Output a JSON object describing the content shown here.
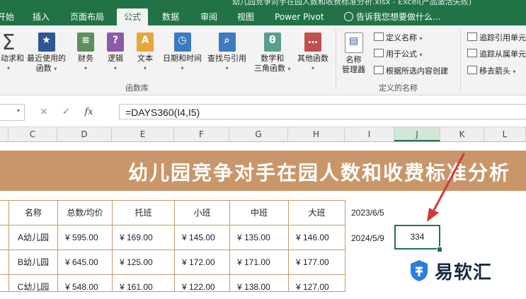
{
  "title_fragment": "幼儿园竞争对手在园人数和收费标准分析.xlsx - Excel(产品激活失败)",
  "tabs": [
    {
      "label": "开始",
      "active": false
    },
    {
      "label": "插入",
      "active": false
    },
    {
      "label": "页面布局",
      "active": false
    },
    {
      "label": "公式",
      "active": true
    },
    {
      "label": "数据",
      "active": false
    },
    {
      "label": "审阅",
      "active": false
    },
    {
      "label": "视图",
      "active": false
    },
    {
      "label": "Power Pivot",
      "active": false
    }
  ],
  "tell_me": "告诉我您想要做什么...",
  "ribbon": {
    "function_library": {
      "label": "函数库",
      "buttons": [
        {
          "label": "自动求和",
          "icon": "sigma-icon"
        },
        {
          "label1": "最近使用的",
          "label2": "函数",
          "icon": "star-book-icon"
        },
        {
          "label": "财务",
          "icon": "coins-book-icon"
        },
        {
          "label": "逻辑",
          "icon": "question-book-icon"
        },
        {
          "label": "文本",
          "icon": "letter-a-book-icon"
        },
        {
          "label": "日期和时间",
          "icon": "clock-book-icon"
        },
        {
          "label": "查找与引用",
          "icon": "magnifier-book-icon"
        },
        {
          "label1": "数学和",
          "label2": "三角函数",
          "icon": "theta-book-icon"
        },
        {
          "label": "其他函数",
          "icon": "more-book-icon"
        }
      ]
    },
    "defined_names": {
      "label": "定义的名称",
      "name_manager1": "名称",
      "name_manager2": "管理器",
      "define_name": "定义名称",
      "use_in_formula": "用于公式",
      "create_from_selection": "根据所选内容创建"
    },
    "formula_auditing": {
      "trace_precedents": "追踪引用单元格",
      "trace_dependents": "追踪从属单元格",
      "remove_arrows": "移去箭头"
    }
  },
  "formula_bar": {
    "name_box": "",
    "cancel_icon": "×",
    "enter_icon": "✓",
    "fx_label": "fx",
    "formula": "=DAYS360(I4,I5)"
  },
  "columns": [
    "C",
    "D",
    "E",
    "F",
    "G",
    "H",
    "I",
    "J",
    "K",
    "L"
  ],
  "selected_column": "J",
  "sheet": {
    "banner_title": "幼儿园竞争对手在园人数和收费标准分析",
    "headers": [
      "名称",
      "总数/均价",
      "托班",
      "小班",
      "中班",
      "大班"
    ],
    "rows": [
      [
        "A幼儿园",
        "¥  595.00",
        "¥  169.00",
        "¥  145.00",
        "¥  135.00",
        "¥  146.00"
      ],
      [
        "B幼儿园",
        "¥  645.00",
        "¥  125.00",
        "¥  172.00",
        "¥  171.00",
        "¥  177.00"
      ],
      [
        "C幼儿园",
        "¥  548.00",
        "¥  161.00",
        "¥  122.00",
        "¥  138.00",
        "¥  127.00"
      ]
    ],
    "i4": "2023/6/5",
    "i5": "2024/5/9",
    "j5": "334"
  },
  "watermark": "易软汇",
  "colors": {
    "excel_green": "#217346",
    "banner": "#c99669",
    "table_border": "#c79a6a",
    "arrow": "#d23a36"
  }
}
